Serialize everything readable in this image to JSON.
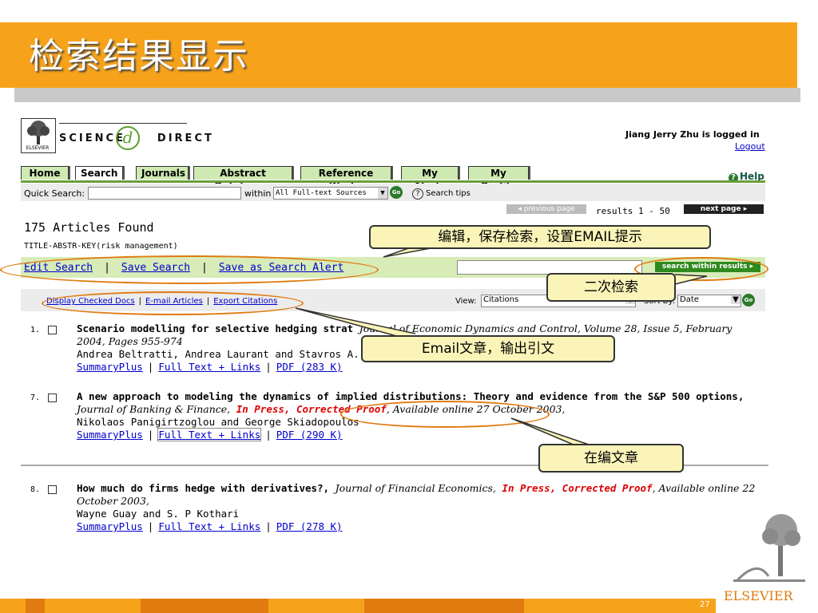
{
  "slide": {
    "title": "检索结果显示",
    "page_number": "27",
    "footer_brand": "ELSEVIER"
  },
  "header": {
    "logo_text": "ELSEVIER",
    "wordmark_left": "SCIENCE",
    "wordmark_right": "DIRECT",
    "logged_in": "Jiang Jerry Zhu is logged in",
    "logout": "Logout"
  },
  "nav": {
    "tabs": [
      "Home",
      "Search",
      "Journals",
      "Abstract Databases",
      "Reference Works",
      "My Alerts",
      "My Profile"
    ],
    "help": "Help"
  },
  "quick_search": {
    "label": "Quick Search:",
    "value": "",
    "within_label": "within",
    "within_value": "All Full-text Sources",
    "go": "Go",
    "tips": "Search tips"
  },
  "paging": {
    "previous": "◂ previous page",
    "range": "results 1 - 50",
    "next": "next page ▸"
  },
  "results_info": {
    "found": "175 Articles Found",
    "query": "TITLE-ABSTR-KEY(risk management)"
  },
  "edit_bar": {
    "edit_search": "Edit Search",
    "save_search": "Save Search",
    "save_alert": "Save as Search Alert",
    "within_results": "search within results ▸"
  },
  "display_bar": {
    "display_checked": "Display Checked Docs",
    "email_articles": "E-mail Articles",
    "export_citations": "Export Citations",
    "view_label": "View:",
    "view_value": "Citations",
    "sort_label": "Sort By:",
    "sort_value": "Date",
    "go": "Go"
  },
  "results": [
    {
      "num": "1.",
      "title": "Scenario modelling for selective hedging strat",
      "journal": "Journal of Economic Dynamics and Control, Volume 28, Issue 5, February 2004, Pages 955-974",
      "authors": "Andrea Beltratti, Andrea Laurant and Stavros A.",
      "links": [
        "SummaryPlus",
        "Full Text + Links",
        "PDF (283 K)"
      ]
    },
    {
      "num": "7.",
      "title": "A new approach to modeling the dynamics of implied distributions: Theory and evidence from the S&P 500 options,",
      "journal": "Journal of Banking & Finance,",
      "status": "In Press, Corrected Proof",
      "avail": ", Available online 27 October 2003,",
      "authors": "Nikolaos Panigirtzoglou and George Skiadopoulos",
      "links": [
        "SummaryPlus",
        "Full Text + Links",
        "PDF (290 K)"
      ]
    },
    {
      "num": "8.",
      "title": "How much do firms hedge with derivatives?,",
      "journal": "Journal of Financial Economics,",
      "status": "In Press, Corrected Proof",
      "avail": ", Available online 22 October 2003,",
      "authors": "Wayne Guay and S. P Kothari",
      "links": [
        "SummaryPlus",
        "Full Text + Links",
        "PDF (278 K)"
      ]
    }
  ],
  "callouts": {
    "edit": "编辑，保存检索，设置EMAIL提示",
    "secondary": "二次检索",
    "email": "Email文章，输出引文",
    "inpress": "在编文章"
  },
  "colors": {
    "title_bar": "#f7a21b",
    "annotation": "#e07b10",
    "callout_fill": "#fbf4b8",
    "link": "#0000cc",
    "in_press": "#dd0000"
  }
}
